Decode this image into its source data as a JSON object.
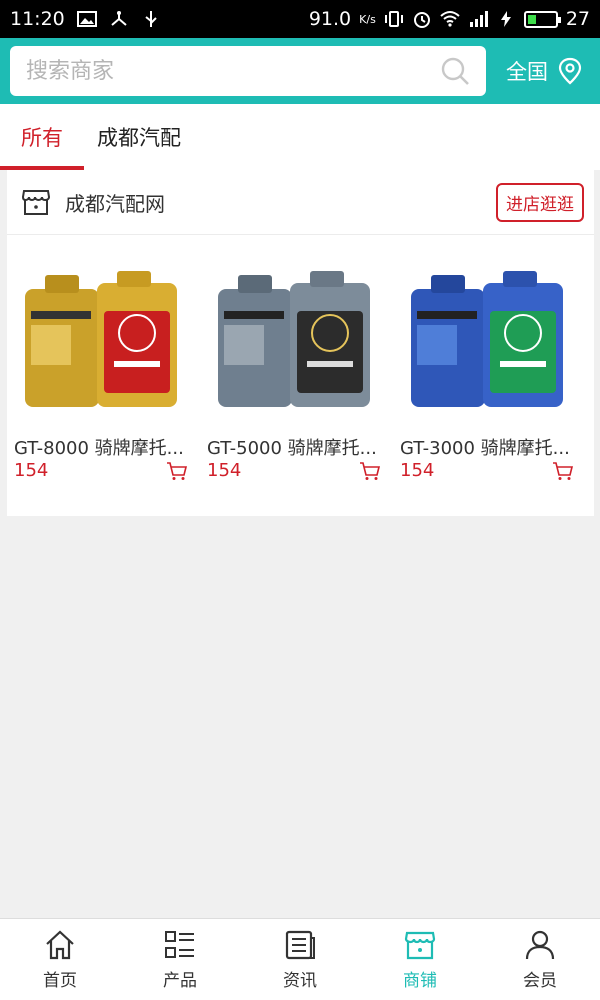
{
  "status_bar": {
    "time": "11:20",
    "speed": "91.0",
    "speed_unit": "K/s",
    "battery": "27"
  },
  "search": {
    "placeholder": "搜索商家"
  },
  "region": {
    "label": "全国"
  },
  "tabs": [
    {
      "label": "所有",
      "active": true
    },
    {
      "label": "成都汽配",
      "active": false
    }
  ],
  "shop": {
    "name": "成都汽配网",
    "enter_label": "进店逛逛",
    "products": [
      {
        "title": "GT-8000 骑牌摩托...",
        "price": "154",
        "theme": "gold"
      },
      {
        "title": "GT-5000 骑牌摩托...",
        "price": "154",
        "theme": "gray"
      },
      {
        "title": "GT-3000 骑牌摩托...",
        "price": "154",
        "theme": "blue"
      }
    ]
  },
  "bottom_nav": [
    {
      "label": "首页",
      "icon": "home-icon",
      "active": false
    },
    {
      "label": "产品",
      "icon": "list-icon",
      "active": false
    },
    {
      "label": "资讯",
      "icon": "news-icon",
      "active": false
    },
    {
      "label": "商铺",
      "icon": "store-icon",
      "active": true
    },
    {
      "label": "会员",
      "icon": "user-icon",
      "active": false
    }
  ],
  "colors": {
    "accent": "#1ebcb4",
    "red": "#d0202a"
  }
}
